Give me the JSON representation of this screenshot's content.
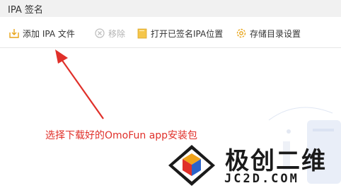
{
  "window": {
    "title": "IPA 签名"
  },
  "toolbar": {
    "add_label": "添加 IPA 文件",
    "remove_label": "移除",
    "open_label": "打开已签名IPA位置",
    "storage_label": "存储目录设置"
  },
  "content": {
    "hint": "选择下载好的OmoFun app安装包",
    "hint_color": "#e0302a"
  },
  "watermark": {
    "name": "极创二维",
    "domain": "JC2D.COM"
  },
  "colors": {
    "accent": "#e8a418",
    "disabled": "#b4b4b4",
    "annotation": "#e0302a"
  },
  "icons": {
    "add": "add-file-icon",
    "remove": "remove-icon",
    "open": "folder-icon",
    "storage": "gear-icon"
  }
}
